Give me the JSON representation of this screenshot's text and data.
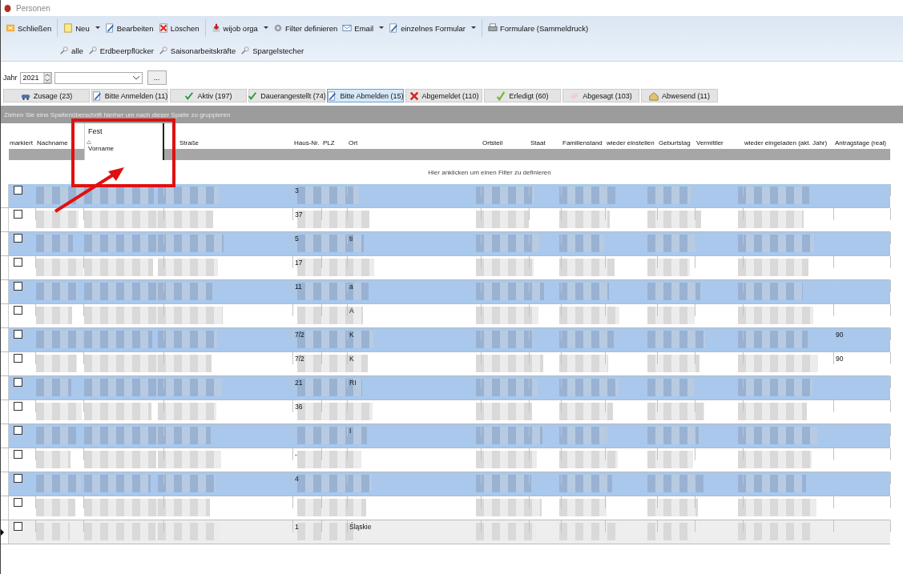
{
  "window": {
    "title": "Personen"
  },
  "toolbar": [
    {
      "label": "Schließen",
      "kind": "close",
      "dropdown": false
    },
    {
      "label": "Neu",
      "kind": "new",
      "dropdown": true
    },
    {
      "label": "Bearbeiten",
      "kind": "edit",
      "dropdown": false
    },
    {
      "label": "Löschen",
      "kind": "delete",
      "dropdown": false
    },
    {
      "label": "wijob orga",
      "kind": "download",
      "dropdown": true
    },
    {
      "label": "Filter definieren",
      "kind": "gear",
      "dropdown": false
    },
    {
      "label": "Email",
      "kind": "mail",
      "dropdown": true
    },
    {
      "label": "einzelnes Formular",
      "kind": "edit",
      "dropdown": true
    },
    {
      "label": "Formulare (Sammeldruck)",
      "kind": "print",
      "dropdown": false
    }
  ],
  "filter_toolbar": [
    "alle",
    "Erdbeerpflücker",
    "Saisonarbeitskräfte",
    "Spargelstecher"
  ],
  "year": {
    "label": "Jahr",
    "value": "2021",
    "more_button": "..."
  },
  "tabs": [
    {
      "label": "Zusage (23)",
      "kind": "car",
      "selected": false
    },
    {
      "label": "Bitte Anmelden (11)",
      "kind": "edit",
      "selected": false
    },
    {
      "label": "Aktiv (197)",
      "kind": "check",
      "selected": false
    },
    {
      "label": "Dauerangestellt (74)",
      "kind": "check",
      "selected": false
    },
    {
      "label": "Bitte Abmelden (15)",
      "kind": "edit",
      "selected": true
    },
    {
      "label": "Abgemeldet (110)",
      "kind": "cross",
      "selected": false
    },
    {
      "label": "Erledigt (60)",
      "kind": "tick",
      "selected": false
    },
    {
      "label": "Abgesagt (103)",
      "kind": "eraser",
      "selected": false
    },
    {
      "label": "Abwesend (11)",
      "kind": "house",
      "selected": false
    }
  ],
  "group_panel": "Ziehen Sie eine Spaltenüberschrift hierher um nach dieser Spalte zu gruppieren",
  "table": {
    "band": "Fest",
    "columns": [
      "markiert",
      "Nachname",
      "Vorname",
      "Straße",
      "Haus-Nr.",
      "PLZ",
      "Ort",
      "Ortsteil",
      "Staat",
      "Familienstand",
      "wieder einstellen",
      "Geburtstag",
      "Vermittler",
      "wieder eingeladen (akt. Jahr)",
      "Antragstage (real)"
    ],
    "filter_hint": "Hier anklicken um einen Filter zu definieren",
    "rows": [
      {
        "checked": false,
        "focused": false,
        "haus_nr": "3",
        "ort": "",
        "antragstage": ""
      },
      {
        "checked": false,
        "focused": false,
        "haus_nr": "37",
        "ort": "",
        "antragstage": ""
      },
      {
        "checked": false,
        "focused": false,
        "haus_nr": "5",
        "ort": "ti",
        "antragstage": ""
      },
      {
        "checked": false,
        "focused": false,
        "haus_nr": "17",
        "ort": "",
        "antragstage": ""
      },
      {
        "checked": false,
        "focused": false,
        "haus_nr": "11",
        "ort": "a",
        "antragstage": ""
      },
      {
        "checked": false,
        "focused": false,
        "haus_nr": "",
        "ort": "A",
        "antragstage": ""
      },
      {
        "checked": false,
        "focused": false,
        "haus_nr": "7/2",
        "ort": "K",
        "antragstage": "90"
      },
      {
        "checked": false,
        "focused": false,
        "haus_nr": "7/2",
        "ort": "K",
        "antragstage": "90"
      },
      {
        "checked": false,
        "focused": false,
        "haus_nr": "21",
        "ort": "RI",
        "antragstage": ""
      },
      {
        "checked": false,
        "focused": false,
        "haus_nr": "36",
        "ort": "",
        "antragstage": ""
      },
      {
        "checked": false,
        "focused": false,
        "haus_nr": "",
        "ort": "I",
        "antragstage": ""
      },
      {
        "checked": false,
        "focused": false,
        "haus_nr": "-",
        "ort": "",
        "antragstage": ""
      },
      {
        "checked": false,
        "focused": false,
        "haus_nr": "4",
        "ort": "",
        "antragstage": ""
      },
      {
        "checked": false,
        "focused": false,
        "haus_nr": "",
        "ort": "",
        "antragstage": ""
      },
      {
        "checked": false,
        "focused": true,
        "haus_nr": "1",
        "ort": "Śląskie",
        "antragstage": ""
      }
    ]
  }
}
